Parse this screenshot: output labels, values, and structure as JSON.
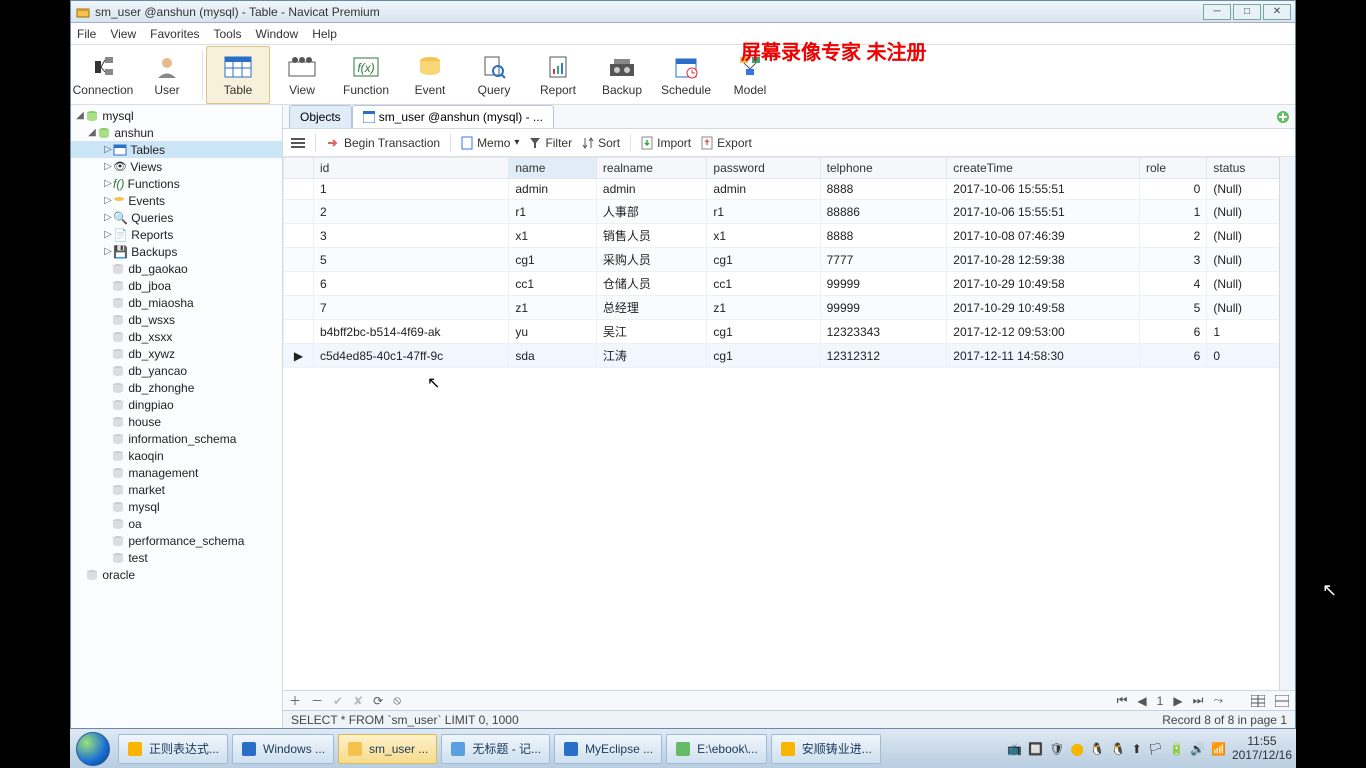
{
  "window": {
    "title": "sm_user @anshun (mysql) - Table - Navicat Premium"
  },
  "menu": {
    "file": "File",
    "view": "View",
    "favorites": "Favorites",
    "tools": "Tools",
    "window": "Window",
    "help": "Help"
  },
  "toolbar": {
    "connection": "Connection",
    "user": "User",
    "table": "Table",
    "view": "View",
    "function": "Function",
    "event": "Event",
    "query": "Query",
    "report": "Report",
    "backup": "Backup",
    "schedule": "Schedule",
    "model": "Model"
  },
  "overlay": "屏幕录像专家  未注册",
  "tree": {
    "root": "mysql",
    "conn": "anshun",
    "tables": "Tables",
    "views": "Views",
    "functions": "Functions",
    "events": "Events",
    "queries": "Queries",
    "reports": "Reports",
    "backups": "Backups",
    "dbs": [
      "db_gaokao",
      "db_jboa",
      "db_miaosha",
      "db_wsxs",
      "db_xsxx",
      "db_xywz",
      "db_yancao",
      "db_zhonghe",
      "dingpiao",
      "house",
      "information_schema",
      "kaoqin",
      "management",
      "market",
      "mysql",
      "oa",
      "performance_schema",
      "test"
    ],
    "oracle": "oracle"
  },
  "tabs": {
    "objects": "Objects",
    "table": "sm_user @anshun (mysql) - ..."
  },
  "actions": {
    "begin": "Begin Transaction",
    "memo": "Memo",
    "filter": "Filter",
    "sort": "Sort",
    "import": "Import",
    "export": "Export"
  },
  "columns": {
    "id": "id",
    "name": "name",
    "realname": "realname",
    "password": "password",
    "telphone": "telphone",
    "createTime": "createTime",
    "role": "role",
    "status": "status"
  },
  "rows": [
    {
      "id": "1",
      "name": "admin",
      "realname": "admin",
      "password": "admin",
      "telphone": "8888",
      "createTime": "2017-10-06 15:55:51",
      "role": "0",
      "status": "(Null)"
    },
    {
      "id": "2",
      "name": "r1",
      "realname": "人事部",
      "password": "r1",
      "telphone": "88886",
      "createTime": "2017-10-06 15:55:51",
      "role": "1",
      "status": "(Null)"
    },
    {
      "id": "3",
      "name": "x1",
      "realname": "销售人员",
      "password": "x1",
      "telphone": "8888",
      "createTime": "2017-10-08 07:46:39",
      "role": "2",
      "status": "(Null)"
    },
    {
      "id": "5",
      "name": "cg1",
      "realname": "采购人员",
      "password": "cg1",
      "telphone": "7777",
      "createTime": "2017-10-28 12:59:38",
      "role": "3",
      "status": "(Null)"
    },
    {
      "id": "6",
      "name": "cc1",
      "realname": "仓储人员",
      "password": "cc1",
      "telphone": "99999",
      "createTime": "2017-10-29 10:49:58",
      "role": "4",
      "status": "(Null)"
    },
    {
      "id": "7",
      "name": "z1",
      "realname": "总经理",
      "password": "z1",
      "telphone": "99999",
      "createTime": "2017-10-29 10:49:58",
      "role": "5",
      "status": "(Null)"
    },
    {
      "id": "b4bff2bc-b514-4f69-ak",
      "name": "yu",
      "realname": "吴江",
      "password": "cg1",
      "telphone": "12323343",
      "createTime": "2017-12-12 09:53:00",
      "role": "6",
      "status": "1"
    },
    {
      "id": "c5d4ed85-40c1-47ff-9c",
      "name": "sda",
      "realname": "江涛",
      "password": "cg1",
      "telphone": "12312312",
      "createTime": "2017-12-11 14:58:30",
      "role": "6",
      "status": "0"
    }
  ],
  "paginator": {
    "page": "1"
  },
  "status": {
    "sql": "SELECT * FROM `sm_user` LIMIT 0, 1000",
    "record": "Record 8 of 8 in page 1"
  },
  "taskbar": {
    "items": [
      {
        "label": "正则表达式..."
      },
      {
        "label": "Windows ..."
      },
      {
        "label": "sm_user ..."
      },
      {
        "label": "无标题 - 记..."
      },
      {
        "label": "MyEclipse ..."
      },
      {
        "label": "E:\\ebook\\..."
      },
      {
        "label": "安顺铸业进..."
      }
    ],
    "clock": {
      "time": "11:55",
      "date": "2017/12/16"
    }
  }
}
